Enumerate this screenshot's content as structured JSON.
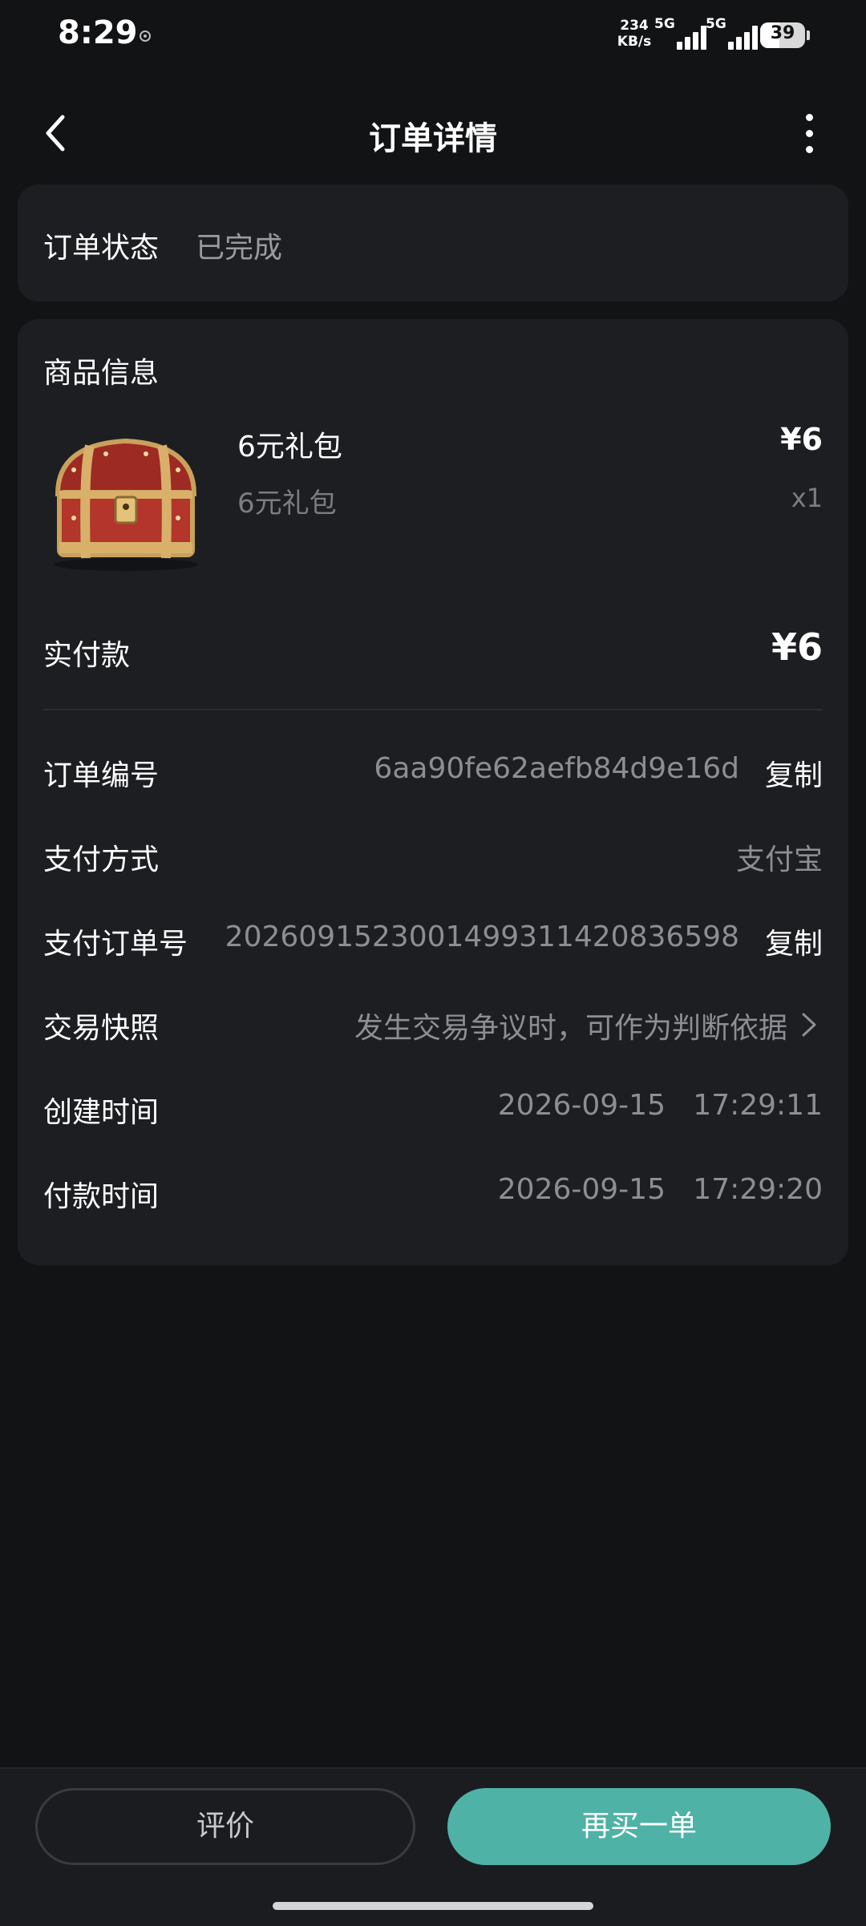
{
  "status_bar": {
    "time": "8:29",
    "net_speed_value": "234",
    "net_speed_unit": "KB/s",
    "sim1_label": "5G",
    "sim2_label": "5G",
    "battery": "39"
  },
  "header": {
    "title": "订单详情"
  },
  "order_status": {
    "label": "订单状态",
    "value": "已完成"
  },
  "product_section": {
    "title": "商品信息",
    "name": "6元礼包",
    "subtitle": "6元礼包",
    "price": "¥6",
    "quantity": "x1",
    "icon": "treasure-chest-image"
  },
  "payment": {
    "paid_label": "实付款",
    "paid_value": "¥6"
  },
  "details": {
    "order_no_label": "订单编号",
    "order_no_value": "6aa90fe62aefb84d9e16d",
    "order_no_copy": "复制",
    "pay_method_label": "支付方式",
    "pay_method_value": "支付宝",
    "pay_order_label": "支付订单号",
    "pay_order_value": "2026091523001499311420836598",
    "pay_order_copy": "复制",
    "snapshot_label": "交易快照",
    "snapshot_value": "发生交易争议时，可作为判断依据",
    "created_label": "创建时间",
    "created_value": "2026-09-15   17:29:11",
    "paid_time_label": "付款时间",
    "paid_time_value": "2026-09-15   17:29:20"
  },
  "bottom_bar": {
    "review_label": "评价",
    "rebuy_label": "再买一单"
  },
  "colors": {
    "background": "#121314",
    "card": "#1d1e22",
    "accent": "#4fb2a6",
    "muted_text": "#8d8e93"
  }
}
